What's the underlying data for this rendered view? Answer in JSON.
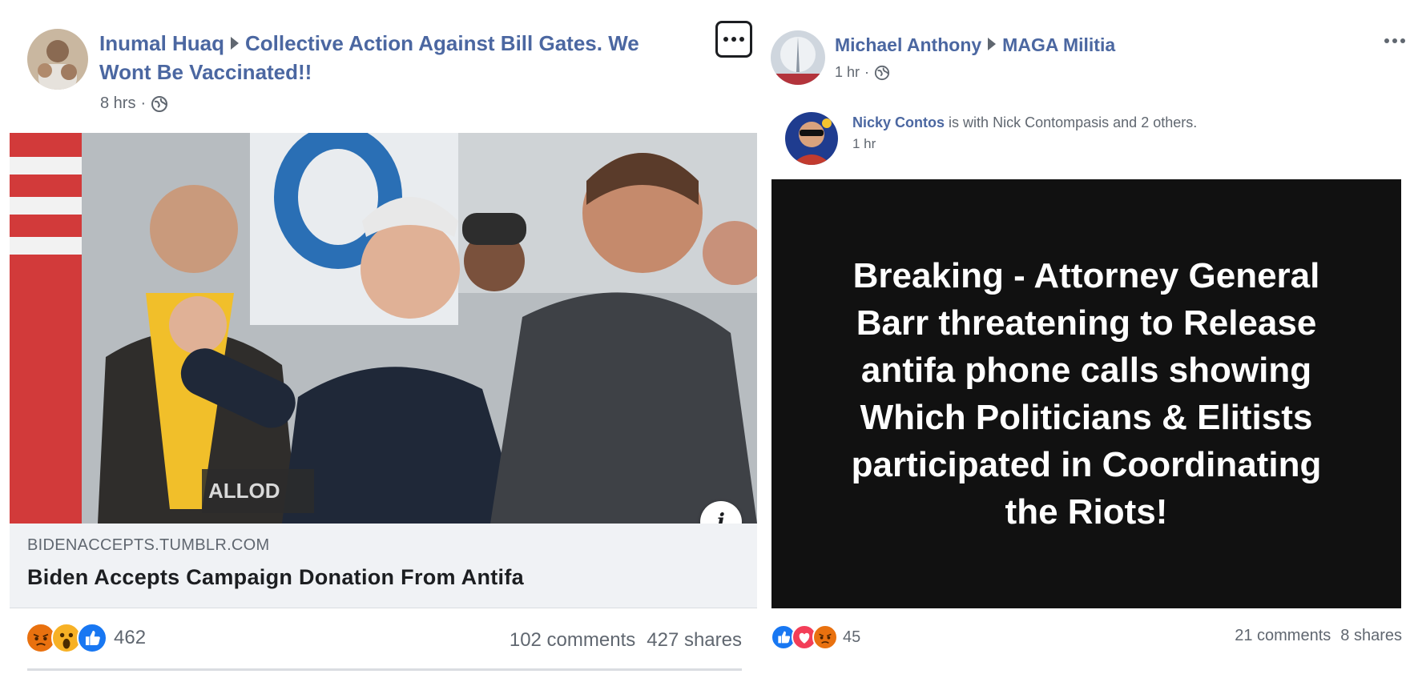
{
  "left_post": {
    "author": "Inumal Huaq",
    "group": "Collective Action Against Bill Gates. We Wont Be Vaccinated!!",
    "time": "8 hrs",
    "privacy_icon": "globe-icon",
    "link": {
      "domain": "BIDENACCEPTS.TUMBLR.COM",
      "title": "Biden Accepts Campaign Donation From Antifa",
      "image_watermark": "ALLOD",
      "info_icon": "i"
    },
    "reactions": [
      "angry",
      "wow",
      "like"
    ],
    "reaction_count": "462",
    "comments": "102 comments",
    "shares": "427 shares"
  },
  "right_post": {
    "author": "Michael Anthony",
    "group": "MAGA Militia",
    "time": "1 hr",
    "privacy_icon": "globe-icon",
    "shared": {
      "name": "Nicky Contos",
      "with_text": "is with",
      "tagged": "Nick Contompasis",
      "and_text": "and",
      "others": "2 others.",
      "time": "1 hr"
    },
    "card_text": "Breaking - Attorney General\nBarr threatening to Release\nantifa phone calls showing\nWhich Politicians & Elitists\nparticipated in Coordinating\nthe Riots!",
    "reactions": [
      "like",
      "love",
      "angry"
    ],
    "reaction_count": "45",
    "comments": "21 comments",
    "shares": "8 shares"
  },
  "colors": {
    "link_blue": "#4b67a1",
    "meta_gray": "#606770",
    "like_blue": "#1877f2",
    "love_red": "#f33e58",
    "angry_orange": "#e9710f",
    "wow_yellow": "#f7b125",
    "card_black": "#111111"
  }
}
